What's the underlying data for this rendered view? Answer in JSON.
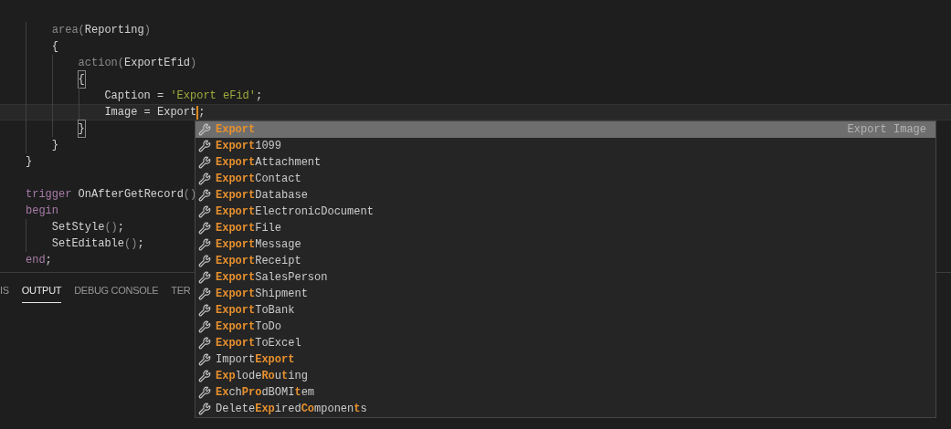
{
  "editor": {
    "lines": [
      {
        "kind": "blank"
      },
      {
        "kind": "code",
        "tokens": [
          {
            "text": "    area",
            "kind": "dim"
          },
          {
            "text": "(",
            "kind": "dim"
          },
          {
            "text": "Reporting",
            "kind": "plain"
          },
          {
            "text": ")",
            "kind": "dim"
          }
        ]
      },
      {
        "kind": "code",
        "tokens": [
          {
            "text": "    {",
            "kind": "plain"
          }
        ]
      },
      {
        "kind": "code",
        "tokens": [
          {
            "text": "        action",
            "kind": "dim"
          },
          {
            "text": "(",
            "kind": "dim"
          },
          {
            "text": "ExportEfid",
            "kind": "plain"
          },
          {
            "text": ")",
            "kind": "dim"
          }
        ]
      },
      {
        "kind": "code",
        "tokens": [
          {
            "text": "        {",
            "kind": "bracket"
          }
        ]
      },
      {
        "kind": "code",
        "tokens": [
          {
            "text": "            Caption = ",
            "kind": "plain"
          },
          {
            "text": "'Export eFid'",
            "kind": "string"
          },
          {
            "text": ";",
            "kind": "plain"
          }
        ]
      },
      {
        "kind": "code",
        "current": true,
        "tokens": [
          {
            "text": "            Image = Export",
            "kind": "plain"
          },
          {
            "kind": "cursor"
          },
          {
            "text": ";",
            "kind": "plain"
          }
        ]
      },
      {
        "kind": "code",
        "tokens": [
          {
            "text": "        }",
            "kind": "bracket"
          }
        ]
      },
      {
        "kind": "code",
        "tokens": [
          {
            "text": "    }",
            "kind": "plain"
          }
        ]
      },
      {
        "kind": "code",
        "tokens": [
          {
            "text": "}",
            "kind": "plain"
          }
        ]
      },
      {
        "kind": "blank"
      },
      {
        "kind": "code",
        "tokens": [
          {
            "text": "trigger",
            "kind": "keyword"
          },
          {
            "text": " OnAfterGetRecord",
            "kind": "plain"
          },
          {
            "text": "()",
            "kind": "dim"
          }
        ]
      },
      {
        "kind": "code",
        "tokens": [
          {
            "text": "begin",
            "kind": "keyword"
          }
        ]
      },
      {
        "kind": "code",
        "tokens": [
          {
            "text": "    SetStyle",
            "kind": "plain"
          },
          {
            "text": "()",
            "kind": "dim"
          },
          {
            "text": ";",
            "kind": "plain"
          }
        ]
      },
      {
        "kind": "code",
        "tokens": [
          {
            "text": "    SetEditable",
            "kind": "plain"
          },
          {
            "text": "()",
            "kind": "dim"
          },
          {
            "text": ";",
            "kind": "plain"
          }
        ]
      },
      {
        "kind": "code",
        "tokens": [
          {
            "text": "end",
            "kind": "keyword"
          },
          {
            "text": ";",
            "kind": "plain"
          }
        ]
      }
    ]
  },
  "panel": {
    "tabs": [
      {
        "label": "IS",
        "selected": false
      },
      {
        "label": "OUTPUT",
        "selected": true
      },
      {
        "label": "DEBUG CONSOLE",
        "selected": false
      },
      {
        "label": "TER",
        "selected": false
      }
    ]
  },
  "suggestions": {
    "detail": "Export Image",
    "items": [
      {
        "selected": true,
        "parts": [
          {
            "text": "Export",
            "match": true
          }
        ]
      },
      {
        "selected": false,
        "parts": [
          {
            "text": "Export",
            "match": true
          },
          {
            "text": "1099",
            "match": false
          }
        ]
      },
      {
        "selected": false,
        "parts": [
          {
            "text": "Export",
            "match": true
          },
          {
            "text": "Attachment",
            "match": false
          }
        ]
      },
      {
        "selected": false,
        "parts": [
          {
            "text": "Export",
            "match": true
          },
          {
            "text": "Contact",
            "match": false
          }
        ]
      },
      {
        "selected": false,
        "parts": [
          {
            "text": "Export",
            "match": true
          },
          {
            "text": "Database",
            "match": false
          }
        ]
      },
      {
        "selected": false,
        "parts": [
          {
            "text": "Export",
            "match": true
          },
          {
            "text": "ElectronicDocument",
            "match": false
          }
        ]
      },
      {
        "selected": false,
        "parts": [
          {
            "text": "Export",
            "match": true
          },
          {
            "text": "File",
            "match": false
          }
        ]
      },
      {
        "selected": false,
        "parts": [
          {
            "text": "Export",
            "match": true
          },
          {
            "text": "Message",
            "match": false
          }
        ]
      },
      {
        "selected": false,
        "parts": [
          {
            "text": "Export",
            "match": true
          },
          {
            "text": "Receipt",
            "match": false
          }
        ]
      },
      {
        "selected": false,
        "parts": [
          {
            "text": "Export",
            "match": true
          },
          {
            "text": "SalesPerson",
            "match": false
          }
        ]
      },
      {
        "selected": false,
        "parts": [
          {
            "text": "Export",
            "match": true
          },
          {
            "text": "Shipment",
            "match": false
          }
        ]
      },
      {
        "selected": false,
        "parts": [
          {
            "text": "Export",
            "match": true
          },
          {
            "text": "ToBank",
            "match": false
          }
        ]
      },
      {
        "selected": false,
        "parts": [
          {
            "text": "Export",
            "match": true
          },
          {
            "text": "ToDo",
            "match": false
          }
        ]
      },
      {
        "selected": false,
        "parts": [
          {
            "text": "Export",
            "match": true
          },
          {
            "text": "ToExcel",
            "match": false
          }
        ]
      },
      {
        "selected": false,
        "parts": [
          {
            "text": "Import",
            "match": false
          },
          {
            "text": "Export",
            "match": true
          }
        ]
      },
      {
        "selected": false,
        "parts": [
          {
            "text": "Exp",
            "match": true
          },
          {
            "text": "lode",
            "match": false
          },
          {
            "text": "Ro",
            "match": true
          },
          {
            "text": "u",
            "match": false
          },
          {
            "text": "t",
            "match": true
          },
          {
            "text": "ing",
            "match": false
          }
        ]
      },
      {
        "selected": false,
        "parts": [
          {
            "text": "Ex",
            "match": true
          },
          {
            "text": "ch",
            "match": false
          },
          {
            "text": "Pro",
            "match": true
          },
          {
            "text": "dBOMI",
            "match": false
          },
          {
            "text": "t",
            "match": true
          },
          {
            "text": "em",
            "match": false
          }
        ]
      },
      {
        "selected": false,
        "parts": [
          {
            "text": "Delete",
            "match": false
          },
          {
            "text": "Exp",
            "match": true
          },
          {
            "text": "ired",
            "match": false
          },
          {
            "text": "Co",
            "match": true
          },
          {
            "text": "mponen",
            "match": false
          },
          {
            "text": "t",
            "match": true
          },
          {
            "text": "s",
            "match": false
          }
        ]
      }
    ]
  }
}
